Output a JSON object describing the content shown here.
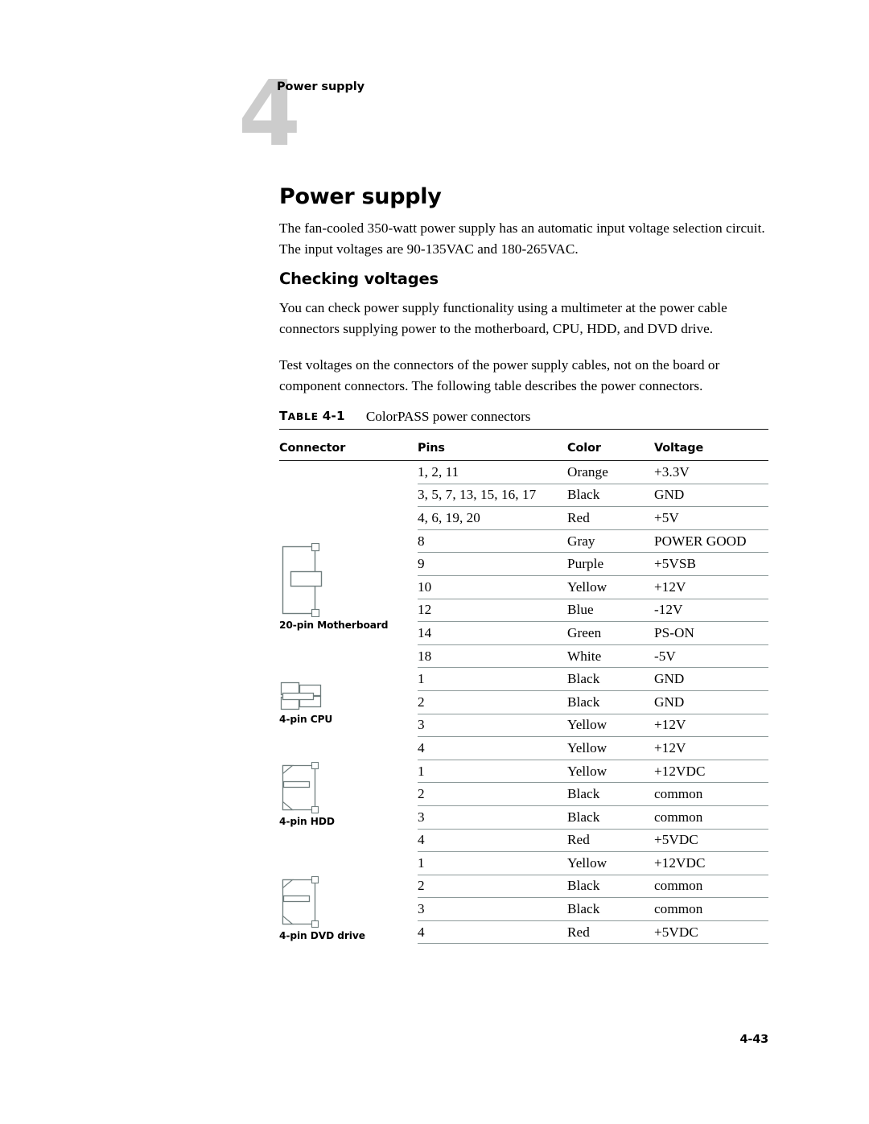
{
  "chapter": {
    "number": "4",
    "running_head": "Power supply"
  },
  "page": {
    "title": "Power supply",
    "intro_paragraph": "The fan-cooled 350-watt power supply has an automatic input voltage selection circuit. The input voltages are 90-135VAC and 180-265VAC.",
    "folio": "4-43"
  },
  "sections": {
    "checking_voltages": {
      "heading": "Checking voltages",
      "paragraph_1": "You can check power supply functionality using a multimeter at the power cable connectors supplying power to the motherboard, CPU, HDD, and DVD drive.",
      "paragraph_2": "Test voltages on the connectors of the power supply cables, not on the board or component connectors. The following table describes the power connectors."
    }
  },
  "table": {
    "label_prefix": "T",
    "label_rest": "ABLE",
    "label_number": "4-1",
    "caption": "ColorPASS power connectors",
    "columns": [
      "Connector",
      "Pins",
      "Color",
      "Voltage"
    ],
    "groups": [
      {
        "connector_label": "20-pin Motherboard",
        "connector_icon": "motherboard-connector-icon",
        "rows": [
          {
            "pins": "1, 2, 11",
            "color": "Orange",
            "voltage": "+3.3V"
          },
          {
            "pins": "3, 5, 7, 13, 15, 16, 17",
            "color": "Black",
            "voltage": "GND"
          },
          {
            "pins": "4, 6, 19, 20",
            "color": "Red",
            "voltage": "+5V"
          },
          {
            "pins": "8",
            "color": "Gray",
            "voltage": "POWER GOOD"
          },
          {
            "pins": "9",
            "color": "Purple",
            "voltage": "+5VSB"
          },
          {
            "pins": "10",
            "color": "Yellow",
            "voltage": "+12V"
          },
          {
            "pins": "12",
            "color": "Blue",
            "voltage": "-12V"
          },
          {
            "pins": "14",
            "color": "Green",
            "voltage": "PS-ON"
          },
          {
            "pins": "18",
            "color": "White",
            "voltage": "-5V"
          }
        ]
      },
      {
        "connector_label": "4-pin CPU",
        "connector_icon": "cpu-connector-icon",
        "rows": [
          {
            "pins": "1",
            "color": "Black",
            "voltage": "GND"
          },
          {
            "pins": "2",
            "color": "Black",
            "voltage": "GND"
          },
          {
            "pins": "3",
            "color": "Yellow",
            "voltage": "+12V"
          },
          {
            "pins": "4",
            "color": "Yellow",
            "voltage": "+12V"
          }
        ]
      },
      {
        "connector_label": "4-pin HDD",
        "connector_icon": "hdd-connector-icon",
        "rows": [
          {
            "pins": "1",
            "color": "Yellow",
            "voltage": "+12VDC"
          },
          {
            "pins": "2",
            "color": "Black",
            "voltage": "common"
          },
          {
            "pins": "3",
            "color": "Black",
            "voltage": "common"
          },
          {
            "pins": "4",
            "color": "Red",
            "voltage": "+5VDC"
          }
        ]
      },
      {
        "connector_label": "4-pin DVD drive",
        "connector_icon": "dvd-connector-icon",
        "rows": [
          {
            "pins": "1",
            "color": "Yellow",
            "voltage": "+12VDC"
          },
          {
            "pins": "2",
            "color": "Black",
            "voltage": "common"
          },
          {
            "pins": "3",
            "color": "Black",
            "voltage": "common"
          },
          {
            "pins": "4",
            "color": "Red",
            "voltage": "+5VDC"
          }
        ]
      }
    ]
  },
  "colors": {
    "chapter_number": "#cccccc",
    "text": "#000000",
    "rule_heavy": "#111111",
    "rule_light": "#8d9a9a",
    "diagram_stroke": "#6f7d7d"
  }
}
